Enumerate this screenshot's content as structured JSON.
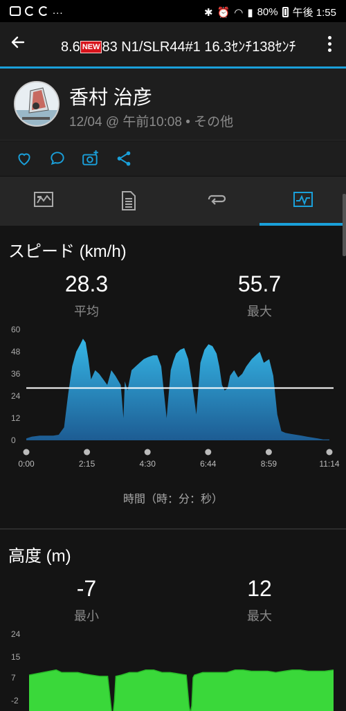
{
  "status_bar": {
    "left_dots": "...",
    "battery": "80%",
    "time": "午後 1:55"
  },
  "app_bar": {
    "title_prefix": "8.6",
    "new_badge": "NEW",
    "title_rest": "83 N1/SLR44#1 16.3ｾﾝﾁ138ｾﾝﾁ"
  },
  "header": {
    "user_name": "香村 治彦",
    "meta": "12/04 @ 午前10:08 • その他"
  },
  "actions": [
    "heart-icon",
    "comment-icon",
    "camera-add-icon",
    "share-icon"
  ],
  "tabs": [
    {
      "icon": "map-icon"
    },
    {
      "icon": "document-icon"
    },
    {
      "icon": "laps-icon"
    },
    {
      "icon": "chart-icon",
      "active": true
    }
  ],
  "speed": {
    "title": "スピード (km/h)",
    "avg_value": "28.3",
    "avg_label": "平均",
    "max_value": "55.7",
    "max_label": "最大",
    "x_title": "時間（時：分：秒）"
  },
  "altitude": {
    "title": "高度 (m)",
    "min_value": "-7",
    "min_label": "最小",
    "max_value": "12",
    "max_label": "最大"
  },
  "chart_data": [
    {
      "type": "area",
      "y_ticks": [
        "60",
        "48",
        "36",
        "24",
        "12",
        "0"
      ],
      "ylim": [
        0,
        60
      ],
      "x_ticks": [
        "0:00",
        "2:15",
        "4:30",
        "6:44",
        "8:59",
        "11:14"
      ],
      "avg_line": 28.3,
      "color": "#2fa6d8",
      "x": [
        0,
        0.2,
        0.5,
        0.8,
        1.0,
        1.2,
        1.4,
        1.55,
        1.7,
        1.85,
        2.0,
        2.1,
        2.2,
        2.3,
        2.4,
        2.55,
        2.7,
        2.85,
        3.0,
        3.15,
        3.3,
        3.5,
        3.6,
        3.65,
        3.75,
        3.9,
        4.05,
        4.2,
        4.35,
        4.5,
        4.7,
        4.85,
        5.0,
        5.2,
        5.35,
        5.45,
        5.55,
        5.7,
        5.85,
        6.0,
        6.15,
        6.3,
        6.45,
        6.6,
        6.75,
        6.9,
        7.05,
        7.15,
        7.25,
        7.35,
        7.45,
        7.55,
        7.7,
        7.85,
        8.0,
        8.15,
        8.35,
        8.5,
        8.65,
        8.8,
        9.0,
        9.15,
        9.3,
        9.45,
        9.6,
        9.8,
        10.0,
        10.2,
        10.4,
        10.6,
        10.8,
        11.0,
        11.23
      ],
      "y": [
        1,
        2,
        2.5,
        2.5,
        2.5,
        3,
        7,
        25,
        40,
        48,
        52,
        55,
        53,
        44,
        33,
        38,
        36,
        33,
        30,
        38,
        35,
        30,
        12,
        32,
        27,
        38,
        40,
        42,
        44,
        45,
        46,
        46,
        40,
        12,
        38,
        43,
        47,
        49,
        50,
        44,
        30,
        14,
        42,
        49,
        52,
        51,
        47,
        40,
        30,
        27,
        28,
        35,
        38,
        34,
        36,
        40,
        44,
        46,
        48,
        42,
        44,
        35,
        14,
        5,
        4,
        3.5,
        3,
        2.5,
        2,
        1.5,
        1,
        0.5,
        0.5
      ]
    },
    {
      "type": "area",
      "y_ticks": [
        "24",
        "15",
        "7",
        "-2"
      ],
      "ylim": [
        -2,
        24
      ],
      "color": "#3ad83a",
      "x": [
        0,
        0.5,
        1.0,
        1.2,
        1.4,
        1.6,
        1.8,
        2.0,
        2.3,
        2.6,
        2.9,
        3.0,
        3.05,
        3.1,
        3.15,
        3.2,
        3.4,
        3.7,
        4.0,
        4.3,
        4.6,
        4.9,
        5.2,
        5.5,
        5.8,
        5.9,
        5.95,
        6.0,
        6.05,
        6.1,
        6.4,
        6.7,
        7.0,
        7.3,
        7.6,
        7.9,
        8.2,
        8.5,
        8.8,
        9.1,
        9.4,
        9.7,
        10.0,
        10.3,
        10.6,
        10.9,
        11.23
      ],
      "y": [
        8,
        9,
        10,
        9,
        9,
        9,
        9,
        8.5,
        8,
        7.5,
        7.5,
        -2,
        -7,
        -7,
        -2,
        7.5,
        8,
        9,
        9,
        10,
        10,
        9,
        9,
        8.5,
        8,
        -4,
        -7,
        -4,
        7,
        8,
        9,
        9,
        9,
        9,
        10,
        10,
        9.5,
        9.5,
        9.5,
        9,
        9.5,
        10,
        10,
        9.5,
        9.5,
        9.5,
        10
      ]
    }
  ]
}
